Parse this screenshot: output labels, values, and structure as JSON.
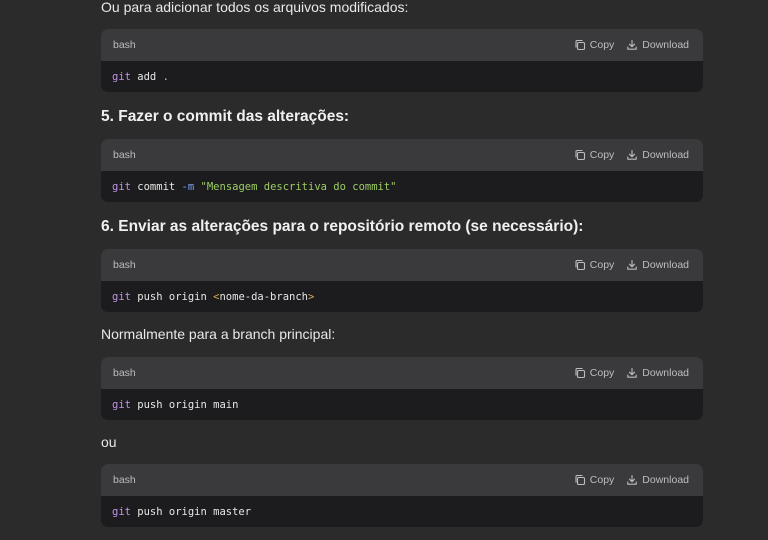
{
  "texts": {
    "intro": "Ou para adicionar todos os arquivos modificados:",
    "heading5": "5. Fazer o commit das alterações:",
    "heading6": "6. Enviar as alterações para o repositório remoto (se necessário):",
    "normally": "Normalmente para a branch principal:",
    "ou": "ou"
  },
  "code_header": {
    "lang": "bash",
    "copy_label": "Copy",
    "download_label": "Download"
  },
  "blocks": [
    {
      "tokens": [
        "git",
        " add ",
        "."
      ]
    },
    {
      "tokens": [
        "git",
        " commit ",
        "-m",
        " ",
        "\"Mensagem descritiva do commit\""
      ]
    },
    {
      "tokens": [
        "git",
        " push origin ",
        "<",
        "nome-da-branch",
        ">"
      ]
    },
    {
      "tokens": [
        "git",
        " push origin main"
      ]
    },
    {
      "tokens": [
        "git",
        " push origin master"
      ]
    }
  ],
  "icons": {
    "copy": "copy-icon",
    "download": "download-icon"
  },
  "colors": {
    "page_bg": "#2b2b2b",
    "code_header_bg": "#3a3a3d",
    "code_body_bg": "#1c1c1e",
    "command": "#c392e8",
    "flag": "#7aa2f7",
    "string": "#9ccc65"
  }
}
